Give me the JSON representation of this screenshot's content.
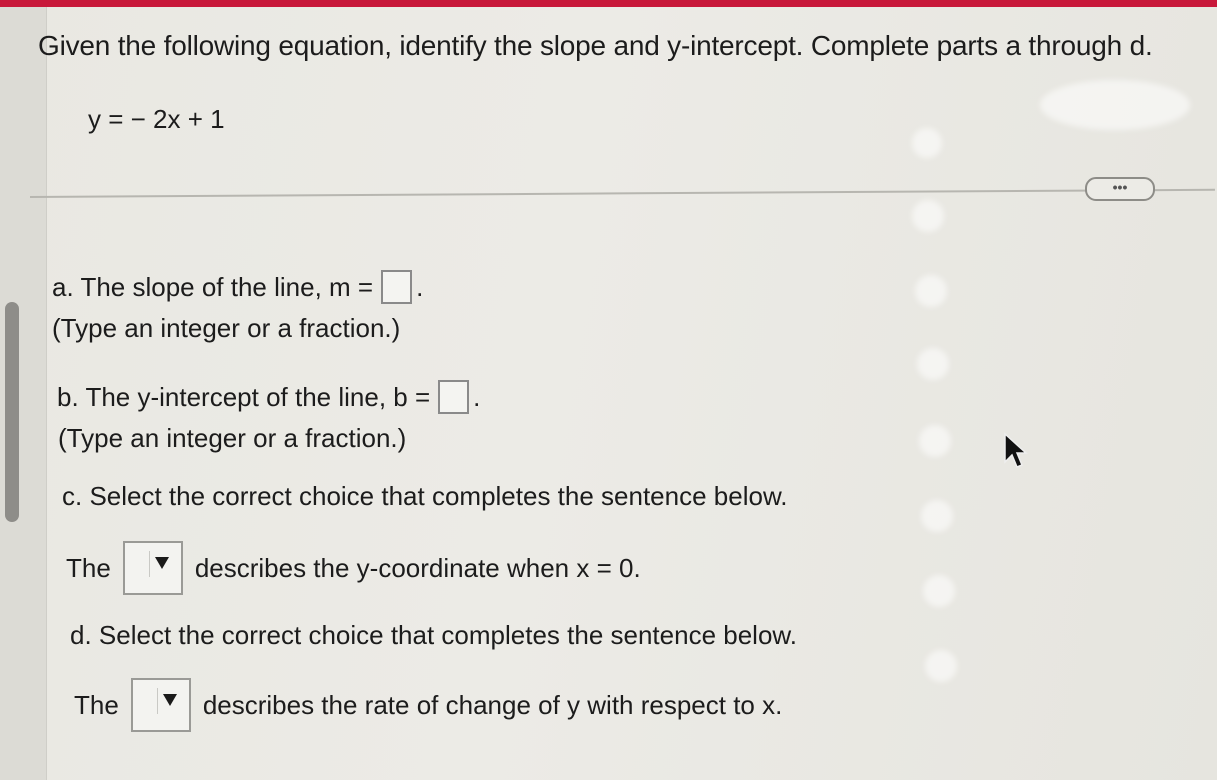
{
  "question": "Given the following equation, identify the slope and y-intercept. Complete parts a through d.",
  "equation": "y = − 2x + 1",
  "more_label": "•••",
  "part_a": {
    "prompt": "a. The slope of the line, m =",
    "suffix": ".",
    "hint": "(Type an integer or a fraction.)",
    "value": ""
  },
  "part_b": {
    "prompt": "b. The y-intercept of the line, b =",
    "suffix": ".",
    "hint": "(Type an integer or a fraction.)",
    "value": ""
  },
  "part_c": {
    "prompt": "c. Select the correct choice that completes the sentence below.",
    "lead": "The",
    "rest": "describes the y-coordinate when x = 0.",
    "selected": ""
  },
  "part_d": {
    "prompt": "d. Select the correct choice that completes the sentence below.",
    "lead": "The",
    "rest": "describes the rate of change of y with respect to x.",
    "selected": ""
  },
  "colors": {
    "accent_bar": "#c8183a",
    "background": "#eae9e4"
  }
}
